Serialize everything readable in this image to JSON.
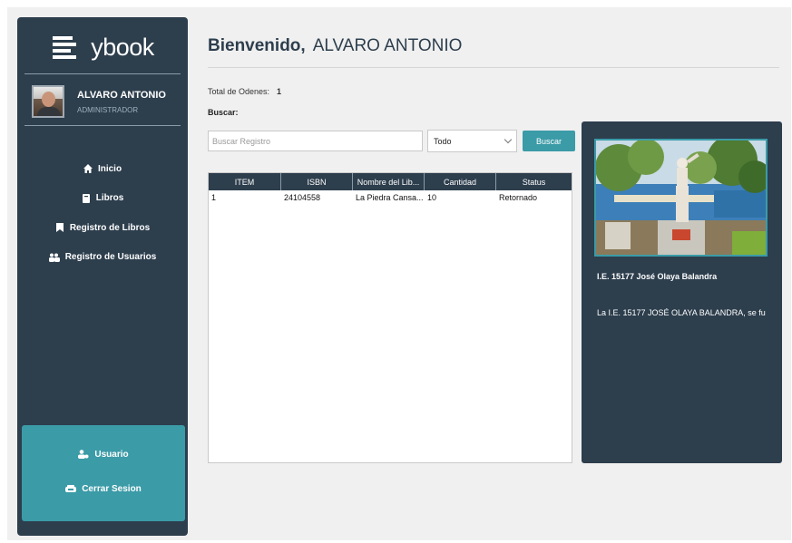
{
  "brand": {
    "name": "ybook"
  },
  "profile": {
    "name": "ALVARO ANTONIO",
    "role": "ADMINISTRADOR"
  },
  "nav": [
    {
      "label": "Inicio",
      "icon": "home-icon"
    },
    {
      "label": "Libros",
      "icon": "book-icon"
    },
    {
      "label": "Registro de Libros",
      "icon": "bookmark-icon"
    },
    {
      "label": "Registro de Usuarios",
      "icon": "users-icon"
    }
  ],
  "bottom_nav": [
    {
      "label": "Usuario",
      "icon": "user-cog-icon"
    },
    {
      "label": "Cerrar Sesion",
      "icon": "logout-icon"
    }
  ],
  "header": {
    "greeting": "Bienvenido,",
    "user": "ALVARO ANTONIO"
  },
  "stats": {
    "total_label": "Total de Odenes:",
    "total_value": "1"
  },
  "search": {
    "label": "Buscar:",
    "placeholder": "Buscar Registro",
    "filter_selected": "Todo",
    "button_label": "Buscar"
  },
  "table": {
    "columns": [
      "ITEM",
      "ISBN",
      "Nombre del Lib...",
      "Cantidad",
      "Status"
    ],
    "rows": [
      [
        "1",
        "24104558",
        "La Piedra Cansa...",
        "10",
        "Retornado"
      ]
    ]
  },
  "card": {
    "title": "I.E. 15177 José Olaya Balandra",
    "text": "La I.E. 15177 JOSÉ OLAYA BALANDRA, se fu"
  },
  "colors": {
    "sidebar": "#2d3e4d",
    "accent": "#3b9ba7",
    "background": "#f0f0f0"
  }
}
